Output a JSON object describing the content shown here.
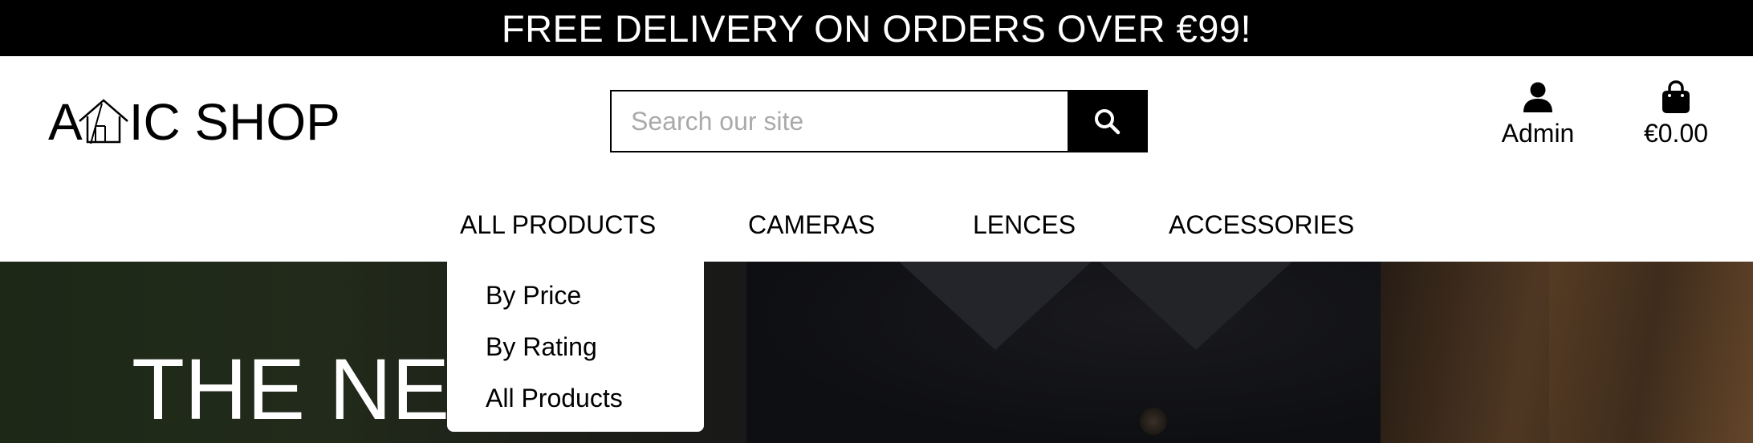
{
  "banner": {
    "text": "FREE DELIVERY ON ORDERS OVER €99!"
  },
  "logo": {
    "prefix": "A",
    "suffix": "IC SHOP"
  },
  "search": {
    "placeholder": "Search our site",
    "button_icon": "search-icon"
  },
  "account": {
    "icon": "user-icon",
    "label": "Admin"
  },
  "cart": {
    "icon": "shopping-bag-icon",
    "total": "€0.00"
  },
  "nav": {
    "items": [
      {
        "label": "All Products"
      },
      {
        "label": "Cameras"
      },
      {
        "label": "Lences"
      },
      {
        "label": "Accessories"
      }
    ]
  },
  "dropdown": {
    "items": [
      {
        "label": "By Price"
      },
      {
        "label": "By Rating"
      },
      {
        "label": "All Products"
      }
    ]
  },
  "hero": {
    "title": "THE NEW"
  },
  "colors": {
    "banner_bg": "#000000",
    "text": "#000000",
    "hero_text": "#ffffff"
  }
}
